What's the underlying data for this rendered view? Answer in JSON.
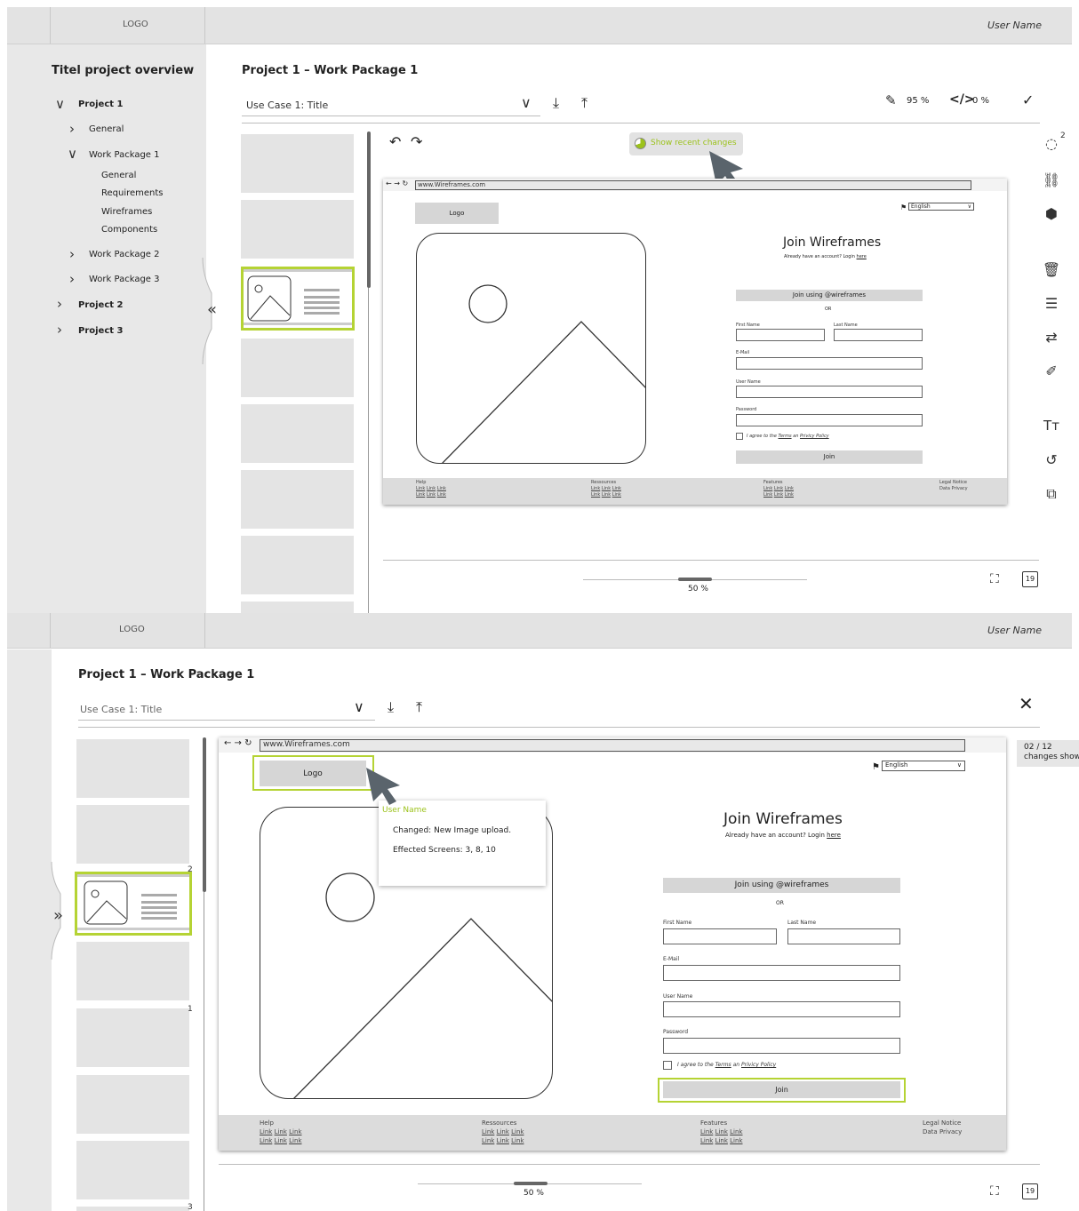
{
  "header": {
    "logo": "LOGO",
    "user_name": "User Name"
  },
  "sidebar": {
    "title": "Titel project overview",
    "tree": [
      {
        "label": "Project 1"
      },
      {
        "label": "General"
      },
      {
        "label": "Work Package 1"
      },
      {
        "label": "General"
      },
      {
        "label": "Requirements"
      },
      {
        "label": "Wireframes"
      },
      {
        "label": "Components"
      },
      {
        "label": "Work Package 2"
      },
      {
        "label": "Work Package 3"
      },
      {
        "label": "Project 2"
      },
      {
        "label": "Project 3"
      }
    ]
  },
  "project": {
    "title": "Project 1 – Work Package 1",
    "usecase": "Use Case 1: Title"
  },
  "toolbar": {
    "edit_percent": "95 %",
    "code_percent": "0 %",
    "recent_changes": "Show recent changes"
  },
  "side_badge": "2",
  "zoom": {
    "value": "50 %"
  },
  "calendar_day": "19",
  "wireframe": {
    "url": "www.Wireframes.com",
    "logo": "Logo",
    "language": "English",
    "join_title": "Join Wireframes",
    "already": "Already have an account? Login",
    "here": "here",
    "join_using": "Join using @wireframes",
    "or": "OR",
    "first_name": "First Name",
    "last_name": "Last Name",
    "email": "E-Mail",
    "user_name": "User Name",
    "password": "Password",
    "agree_prefix": "I agree to the",
    "terms": "Terms",
    "agree_mid": "an",
    "privacy": "Privicy Policy",
    "join_btn": "Join",
    "footer": {
      "help": "Help",
      "resources": "Ressources",
      "features": "Features",
      "legal": "Legal Notice",
      "privacy": "Data Privacy",
      "link": "Link"
    }
  },
  "tooltip": {
    "user": "User Name",
    "changed": "Changed: New Image upload.",
    "effected": "Effected Screens: 3, 8, 10"
  },
  "changes_shown": {
    "count": "02 / 12",
    "label": "changes shown"
  },
  "thumb_badges": {
    "a": "2",
    "b": "1",
    "c": "3"
  }
}
